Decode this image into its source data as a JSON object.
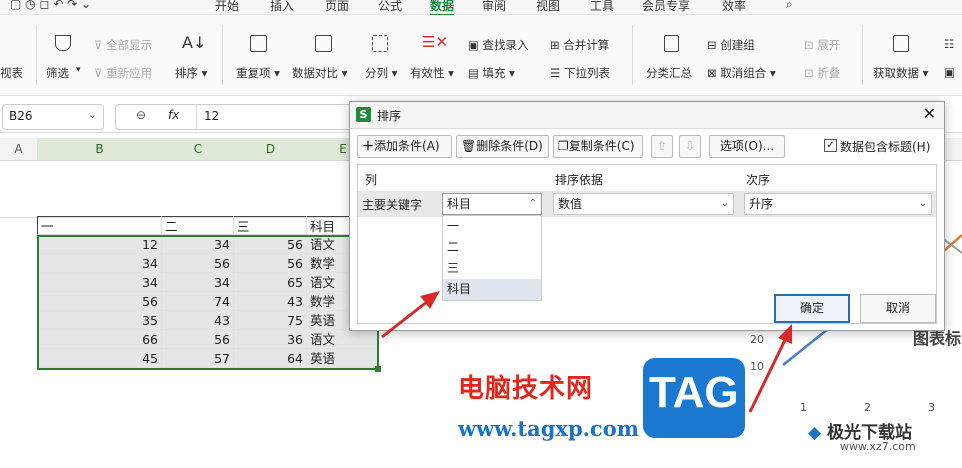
{
  "menu": {
    "items": [
      "开始",
      "插入",
      "页面",
      "公式",
      "数据",
      "审阅",
      "视图",
      "工具",
      "会员专享",
      "效率"
    ],
    "active_index": 4
  },
  "ribbon": {
    "partial_left": "视表",
    "show_all": "全部显示",
    "filter": "筛选",
    "reapply": "重新应用",
    "sort": "排序",
    "duplicates": "重复项",
    "compare": "数据对比",
    "split": "分列",
    "validity": "有效性",
    "find_entry": "查找录入",
    "fill": "填充",
    "merge_calc": "合并计算",
    "dropdown_list": "下拉列表",
    "subtotal": "分类汇总",
    "create_group": "创建组",
    "ungroup": "取消组合",
    "expand": "展开",
    "collapse": "折叠",
    "get_data": "获取数据"
  },
  "formula_bar": {
    "cell_ref": "B26",
    "fx_label": "fx",
    "value": "12"
  },
  "columns": [
    "A",
    "B",
    "C",
    "D",
    "E"
  ],
  "sheet": {
    "headers": [
      "一",
      "二",
      "三",
      "科目"
    ],
    "rows": [
      [
        "12",
        "34",
        "56",
        "语文"
      ],
      [
        "34",
        "56",
        "56",
        "数学"
      ],
      [
        "34",
        "34",
        "65",
        "语文"
      ],
      [
        "56",
        "74",
        "43",
        "数学"
      ],
      [
        "35",
        "43",
        "75",
        "英语"
      ],
      [
        "66",
        "56",
        "36",
        "语文"
      ],
      [
        "45",
        "57",
        "64",
        "英语"
      ]
    ]
  },
  "chart": {
    "title_partial": "图表标",
    "y_ticks": [
      "20",
      "10"
    ],
    "x_ticks": [
      "1",
      "2",
      "3"
    ]
  },
  "dialog": {
    "title": "排序",
    "add_condition": "添加条件(A)",
    "delete_condition": "删除条件(D)",
    "copy_condition": "复制条件(C)",
    "options": "选项(O)...",
    "has_header": "数据包含标题(H)",
    "has_header_checked": true,
    "col_header": "列",
    "basis_header": "排序依据",
    "order_header": "次序",
    "row_label": "主要关键字",
    "key_value": "科目",
    "basis_value": "数值",
    "order_value": "升序",
    "key_options": [
      "一",
      "二",
      "三",
      "科目"
    ],
    "ok": "确定",
    "cancel": "取消"
  },
  "watermark": {
    "site_name": "电脑技术网",
    "url": "www.tagxp.com",
    "tag": "TAG",
    "brand": "极光下载站",
    "brand_url": "www.xz7.com"
  },
  "colors": {
    "accent": "#1f8a3b",
    "selection": "#2e7d32",
    "arrow": "#d42a2a",
    "tag_blue": "#1a78d0"
  }
}
